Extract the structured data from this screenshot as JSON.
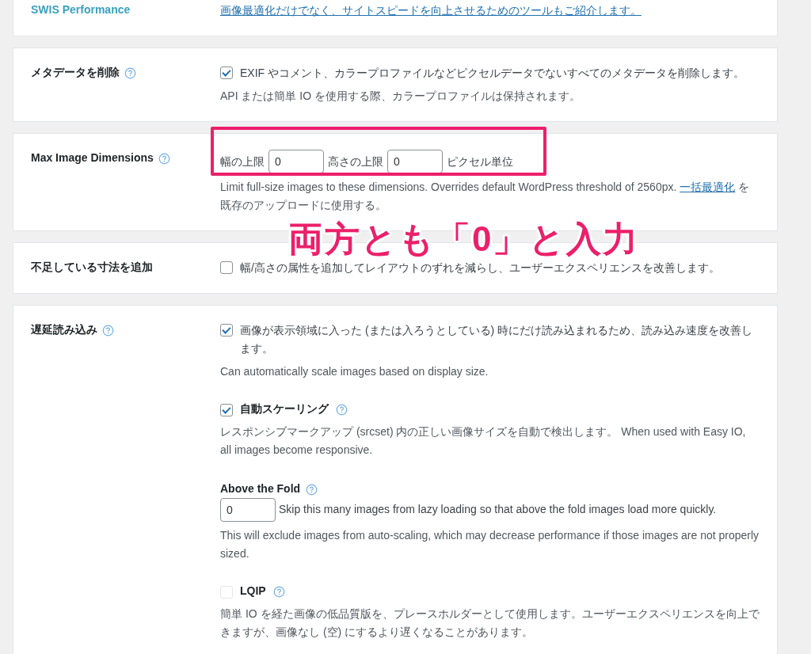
{
  "sections": [
    {
      "label": "SWIS Performance",
      "label_link": true,
      "help": false,
      "items": [
        {
          "kind": "link",
          "text": "画像最適化だけでなく、サイトスピードを向上させるためのツールもご紹介します。"
        }
      ]
    },
    {
      "label": "メタデータを削除",
      "label_link": false,
      "help": true,
      "items": [
        {
          "kind": "checkbox",
          "checked": true,
          "text": "EXIF やコメント、カラープロファイルなどピクセルデータでないすべてのメタデータを削除します。"
        },
        {
          "kind": "note",
          "text": "API または簡単 IO を使用する際、カラープロファイルは保持されます。"
        }
      ]
    },
    {
      "label": "Max Image Dimensions",
      "label_link": false,
      "help": true,
      "items": [
        {
          "kind": "dimensions",
          "width_label": "幅の上限",
          "width_value": "0",
          "height_label": "高さの上限",
          "height_value": "0",
          "unit": "ピクセル単位"
        },
        {
          "kind": "note",
          "text": "Limit full-size images to these dimensions. Overrides default WordPress threshold of 2560px. ",
          "link": "一括最適化",
          "after": " を既存のアップロードに使用する。"
        }
      ]
    },
    {
      "label": "不足している寸法を追加",
      "label_link": false,
      "help": false,
      "items": [
        {
          "kind": "checkbox",
          "checked": false,
          "text": "幅/高さの属性を追加してレイアウトのずれを減らし、ユーザーエクスペリエンスを改善します。"
        }
      ]
    },
    {
      "label": "遅延読み込み",
      "label_link": false,
      "help": true,
      "items": [
        {
          "kind": "checkbox",
          "checked": true,
          "text": "画像が表示領域に入った (または入ろうとしている) 時にだけ読み込まれるため、読み込み速度を改善します。"
        },
        {
          "kind": "note",
          "text": "Can automatically scale images based on display size."
        },
        {
          "kind": "option",
          "checked": true,
          "disabled": false,
          "text": "自動スケーリング",
          "help": true
        },
        {
          "kind": "note",
          "text": "レスポンシブマークアップ (srcset) 内の正しい画像サイズを自動で検出します。 When used with Easy IO, all images become responsive."
        },
        {
          "kind": "heading",
          "text": "Above the Fold",
          "help": true
        },
        {
          "kind": "number",
          "value": "0",
          "text": "Skip this many images from lazy loading so that above the fold images load more quickly."
        },
        {
          "kind": "note",
          "text": "This will exclude images from auto-scaling, which may decrease performance if those images are not properly sized."
        },
        {
          "kind": "option",
          "checked": false,
          "disabled": true,
          "text": "LQIP",
          "help": true
        },
        {
          "kind": "note",
          "text": "簡単 IO を経た画像の低品質版を、プレースホルダーとして使用します。ユーザーエクスペリエンスを向上できますが、画像なし (空) にするより遅くなることがあります。"
        }
      ]
    }
  ],
  "annotation": {
    "caption": "両方とも「0」と入力"
  }
}
